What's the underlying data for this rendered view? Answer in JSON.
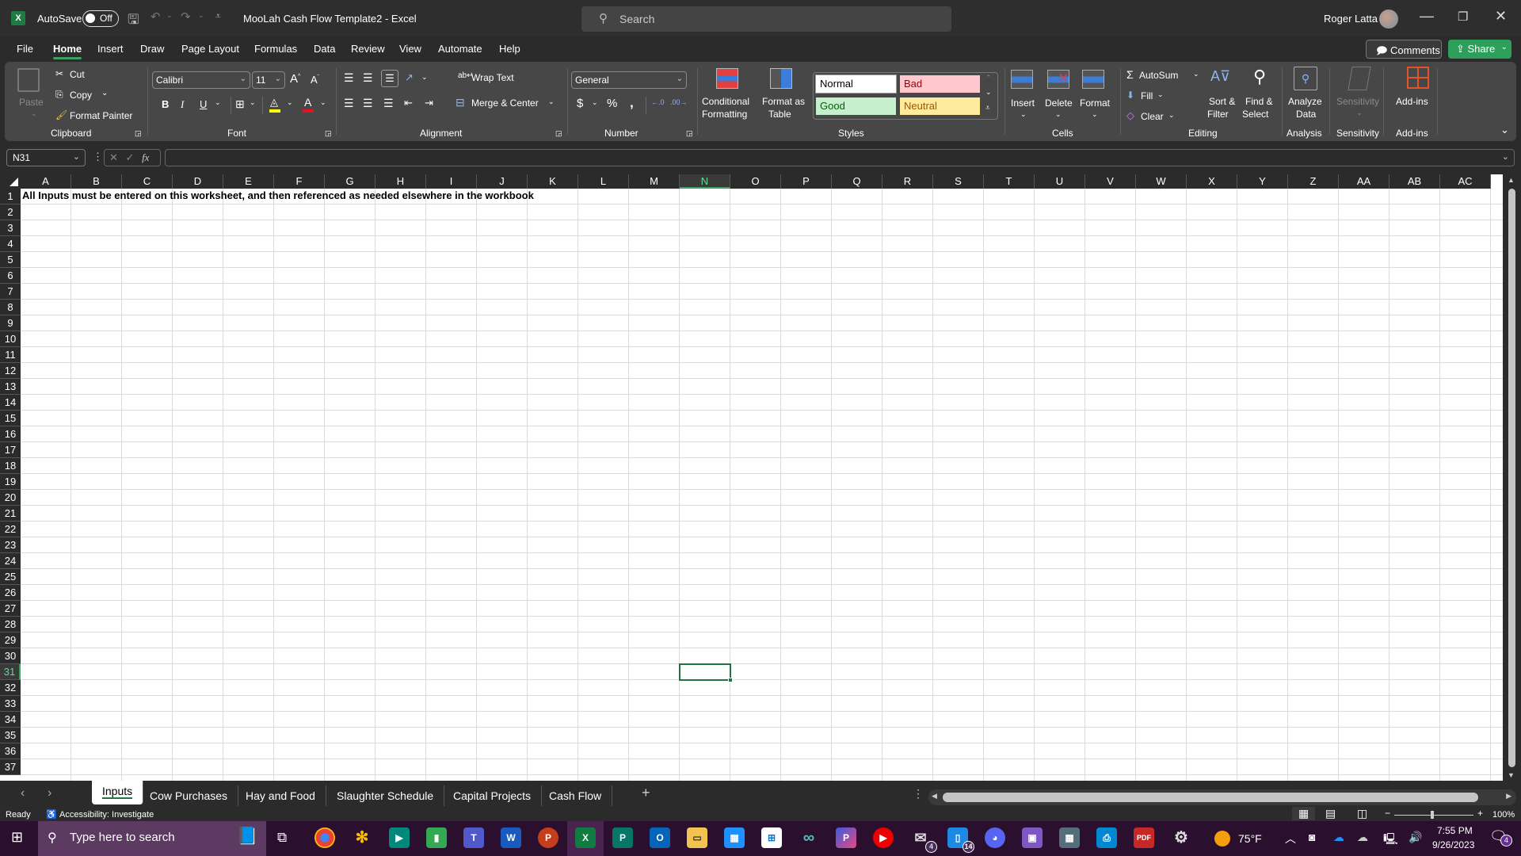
{
  "titlebar": {
    "autosave_label": "AutoSave",
    "autosave_state": "Off",
    "document_title": "MooLah Cash Flow Template2  -  Excel",
    "search_placeholder": "Search",
    "user_name": "Roger Latta"
  },
  "menu": {
    "items": [
      "File",
      "Home",
      "Insert",
      "Draw",
      "Page Layout",
      "Formulas",
      "Data",
      "Review",
      "View",
      "Automate",
      "Help"
    ],
    "active": "Home",
    "comments_label": "Comments",
    "share_label": "Share"
  },
  "ribbon": {
    "clipboard": {
      "paste": "Paste",
      "cut": "Cut",
      "copy": "Copy",
      "format_painter": "Format Painter",
      "label": "Clipboard"
    },
    "font": {
      "family": "Calibri",
      "size": "11",
      "bold": "B",
      "italic": "I",
      "underline": "U",
      "label": "Font",
      "highlight_color": "#ffff00",
      "font_color": "#e81123"
    },
    "alignment": {
      "wrap_text": "Wrap Text",
      "merge_center": "Merge & Center",
      "label": "Alignment"
    },
    "number": {
      "format": "General",
      "currency": "$",
      "percent": "%",
      "comma": ",",
      "label": "Number"
    },
    "styles": {
      "conditional_formatting": [
        "Conditional",
        "Formatting"
      ],
      "format_as_table": [
        "Format as",
        "Table"
      ],
      "normal": "Normal",
      "bad": "Bad",
      "good": "Good",
      "neutral": "Neutral",
      "label": "Styles"
    },
    "cells": {
      "insert": "Insert",
      "delete": "Delete",
      "format": "Format",
      "label": "Cells"
    },
    "editing": {
      "autosum": "AutoSum",
      "fill": "Fill",
      "clear": "Clear",
      "sort_filter": [
        "Sort &",
        "Filter"
      ],
      "find_select": [
        "Find &",
        "Select"
      ],
      "label": "Editing"
    },
    "analysis": {
      "analyze_data": [
        "Analyze",
        "Data"
      ],
      "label": "Analysis"
    },
    "sensitivity": {
      "button": "Sensitivity",
      "label": "Sensitivity"
    },
    "addins": {
      "button": "Add-ins",
      "label": "Add-ins"
    }
  },
  "formula_bar": {
    "name_box": "N31",
    "fx": "fx",
    "value": ""
  },
  "sheet": {
    "columns": [
      "A",
      "B",
      "C",
      "D",
      "E",
      "F",
      "G",
      "H",
      "I",
      "J",
      "K",
      "L",
      "M",
      "N",
      "O",
      "P",
      "Q",
      "R",
      "S",
      "T",
      "U",
      "V",
      "W",
      "X",
      "Y",
      "Z",
      "AA",
      "AB",
      "AC"
    ],
    "rows": [
      "1",
      "2",
      "3",
      "4",
      "5",
      "6",
      "7",
      "8",
      "9",
      "10",
      "11",
      "12",
      "13",
      "14",
      "15",
      "16",
      "17",
      "18",
      "19",
      "20",
      "21",
      "22",
      "23",
      "24",
      "25",
      "26",
      "27",
      "28",
      "29",
      "30",
      "31",
      "32",
      "33",
      "34",
      "35",
      "36",
      "37"
    ],
    "selected_cell": "N31",
    "selected_column": "N",
    "selected_row": "31",
    "cells": {
      "A1": "All Inputs must be entered on this worksheet, and then referenced as needed elsewhere in the workbook"
    }
  },
  "sheet_tabs": {
    "tabs": [
      "Inputs",
      "Cow Purchases",
      "Hay and Food",
      "Slaughter Schedule",
      "Capital Projects",
      "Cash Flow"
    ],
    "active": "Inputs",
    "add": "+"
  },
  "status_bar": {
    "mode": "Ready",
    "accessibility": "Accessibility: Investigate",
    "zoom": "100%"
  },
  "taskbar": {
    "search_placeholder": "Type here to search",
    "weather": "75°F",
    "time": "7:55 PM",
    "date": "9/26/2023",
    "notifications": "4",
    "badges": {
      "mail": "4",
      "phone": "14"
    }
  }
}
